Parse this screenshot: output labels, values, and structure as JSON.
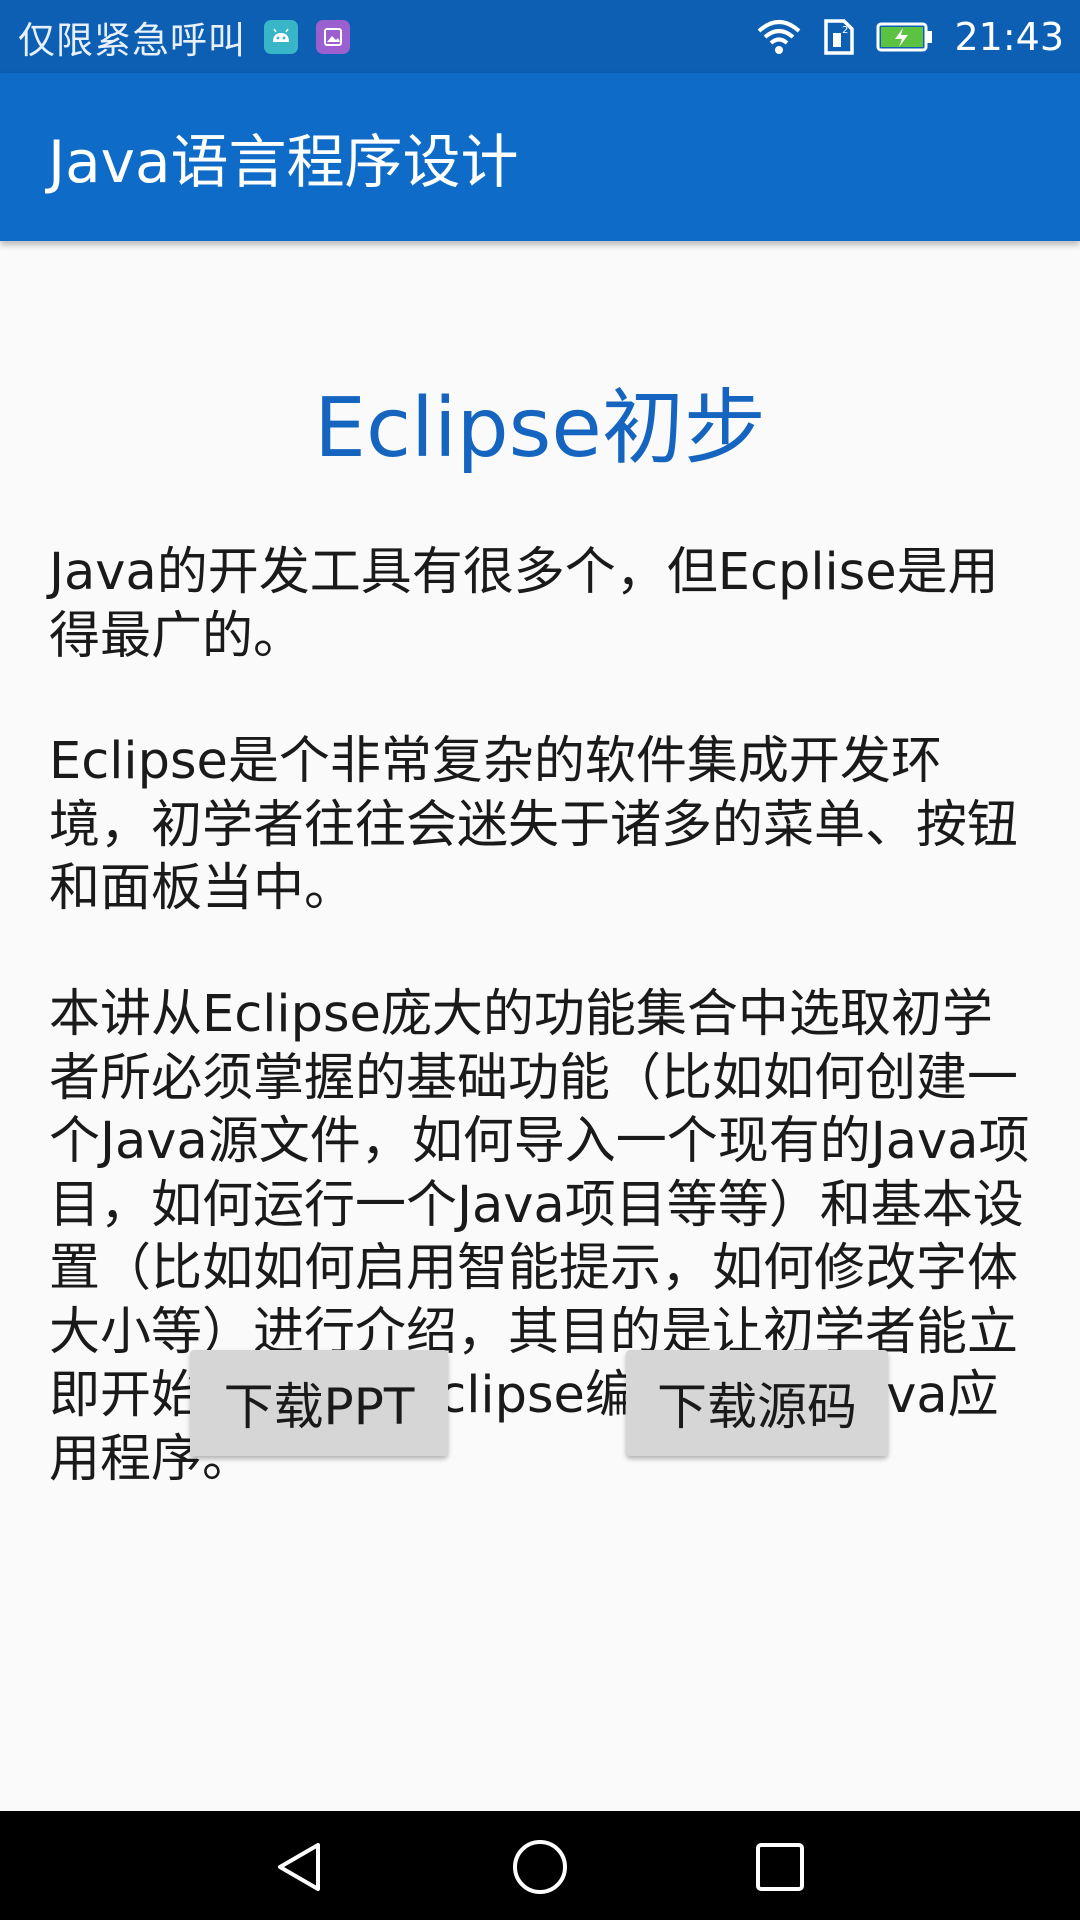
{
  "status_bar": {
    "carrier": "仅限紧急呼叫",
    "time": "21:43",
    "icons": [
      "android-notification-icon",
      "photo-notification-icon",
      "wifi-icon",
      "sim-icon",
      "battery-charging-icon"
    ]
  },
  "app_bar": {
    "title": "Java语言程序设计"
  },
  "content": {
    "heading": "Eclipse初步",
    "paragraphs": [
      "Java的开发工具有很多个，但Ecplise是用得最广的。",
      "Eclipse是个非常复杂的软件集成开发环境，初学者往往会迷失于诸多的菜单、按钮和面板当中。",
      "本讲从Eclipse庞大的功能集合中选取初学者所必须掌握的基础功能（比如如何创建一个Java源文件，如何导入一个现有的Java项目，如何运行一个Java项目等等）和基本设置（比如如何启用智能提示，如何修改字体大小等）进行介绍，其目的是让初学者能立即开始学会使用Eclipse编写简单的Java应用程序。"
    ]
  },
  "buttons": {
    "download_ppt": "下载PPT",
    "download_source": "下载源码"
  },
  "nav_bar": {
    "icons": [
      "back-icon",
      "home-icon",
      "recents-icon"
    ]
  },
  "colors": {
    "status_bar": "#0d5fb3",
    "app_bar": "#0e6cc8",
    "heading": "#1565c0",
    "button": "#d6d6d6"
  }
}
